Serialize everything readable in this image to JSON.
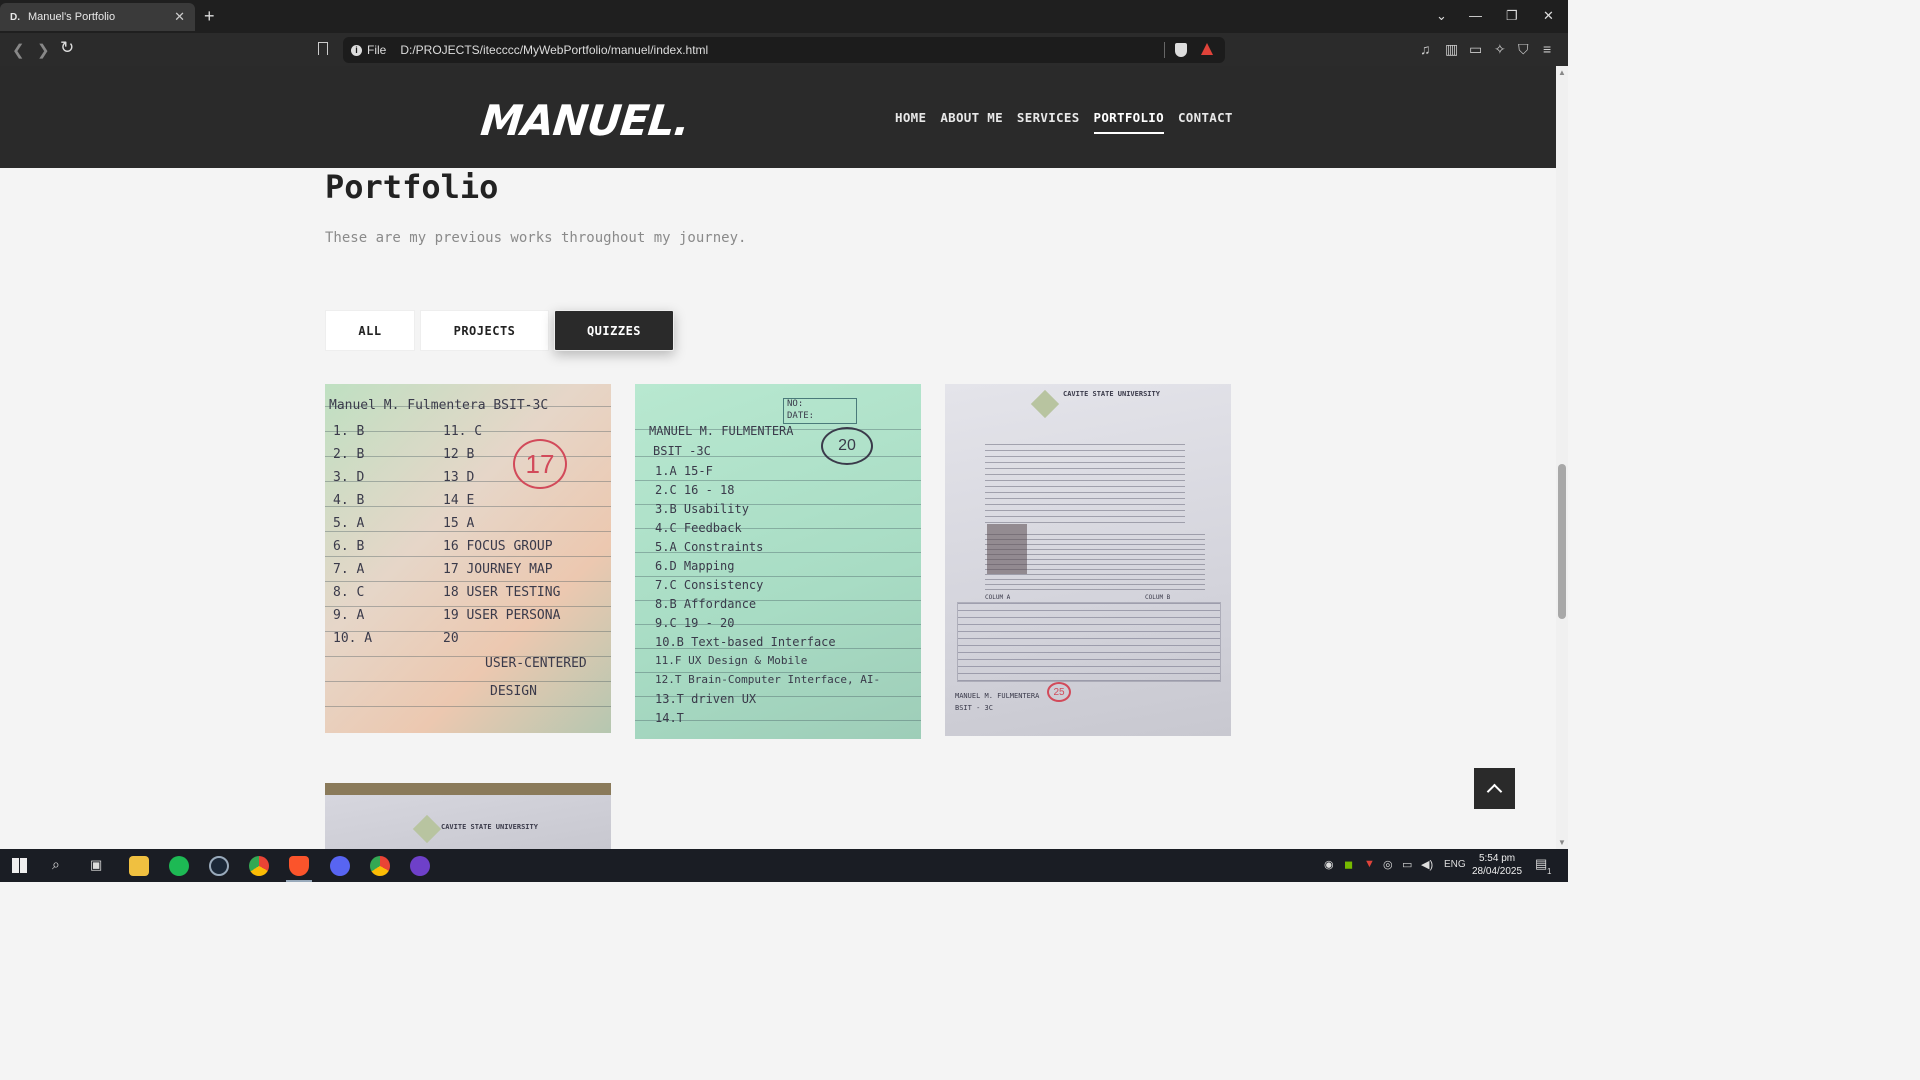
{
  "browser": {
    "tab_favicon": "D.",
    "tab_title": "Manuel's Portfolio",
    "url_prefix": "File",
    "url": "D:/PROJECTS/itecccc/MyWebPortfolio/manuel/index.html"
  },
  "site": {
    "logo": "MANUEL.",
    "nav": [
      "HOME",
      "ABOUT ME",
      "SERVICES",
      "PORTFOLIO",
      "CONTACT"
    ],
    "active_nav": "PORTFOLIO"
  },
  "portfolio": {
    "title": "Portfolio",
    "subtitle": "These are my previous works throughout my journey.",
    "filters": [
      "ALL",
      "PROJECTS",
      "QUIZZES"
    ],
    "active_filter": "QUIZZES"
  },
  "quiz1": {
    "header": "Manuel M. Fulmentera  BSIT-3C",
    "score": "17",
    "left": [
      "1. B",
      "2. B",
      "3. D",
      "4. B",
      "5. A",
      "6. B",
      "7. A",
      "8. C",
      "9. A",
      "10. A"
    ],
    "right": [
      "11. C",
      "12 B",
      "13 D",
      "14 E",
      "15 A",
      "16 FOCUS GROUP",
      "17 JOURNEY MAP",
      "18 USER TESTING",
      "19 USER PERSONA",
      "20",
      "USER-CENTERED",
      "DESIGN"
    ]
  },
  "quiz2": {
    "header": "MANUEL M. FULMENTERA",
    "section": "BSIT -3C",
    "score": "20",
    "box1": "NO:",
    "box2": "DATE:",
    "lines": [
      "1.A    15-F",
      "2.C    16 - 18",
      "3.B    Usability",
      "4.C    Feedback",
      "5.A    Constraints",
      "6.D    Mapping",
      "7.C    Consistency",
      "8.B    Affordance",
      "9.C    19 - 20",
      "10.B   Text-based Interface",
      "11.F   UX Design & Mobile",
      "12.T   Brain-Computer Interface, AI-",
      "13.T   driven UX",
      "14.T"
    ]
  },
  "quiz3": {
    "school": "CAVITE STATE UNIVERSITY",
    "name_line": "MANUEL M. FULMENTERA",
    "section": "BSIT - 3C",
    "score": "25",
    "col_a": "COLUM A",
    "col_b": "COLUM B"
  },
  "quiz4": {
    "school": "CAVITE STATE UNIVERSITY"
  },
  "taskbar": {
    "lang": "ENG",
    "time": "5:54 pm",
    "date": "28/04/2025",
    "notif": "1"
  }
}
